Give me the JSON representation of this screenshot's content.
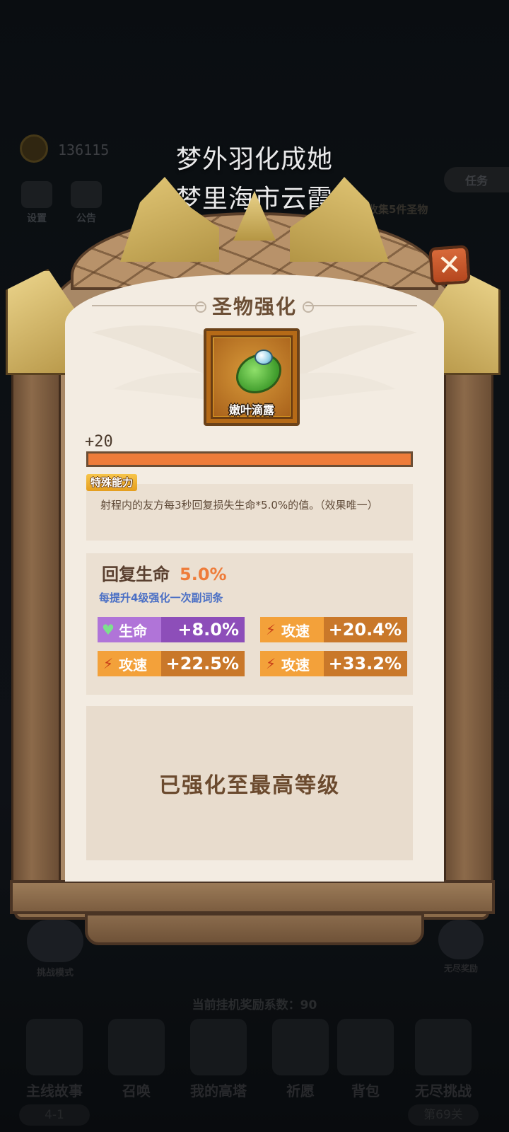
{
  "hud": {
    "coins": "136115",
    "settings_label": "设置",
    "notice_label": "公告",
    "task_label": "任务",
    "task_text": "收集5件圣物"
  },
  "lyrics": {
    "line1": "梦外羽化成她",
    "line2": "梦里海市云霞"
  },
  "panel": {
    "title": "圣物强化",
    "close_icon": "close-icon",
    "item": {
      "name": "嫩叶滴露",
      "icon": "leaf-dew-icon"
    },
    "level": {
      "label": "+20",
      "progress": 1.0
    },
    "special": {
      "tag": "特殊能力",
      "description": "射程内的友方每3秒回复损失生命*5.0%的值。（效果唯一）"
    },
    "main_stat": {
      "name": "回复生命",
      "value": "5.0%"
    },
    "upgrade_note": "每提升4级强化一次副词条",
    "substats": [
      {
        "icon": "heart-icon",
        "name": "生命",
        "value": "+8.0%",
        "color": "#8d4eb9"
      },
      {
        "icon": "bolt-icon",
        "name": "攻速",
        "value": "+20.4%",
        "color": "#c9782a"
      },
      {
        "icon": "bolt-icon",
        "name": "攻速",
        "value": "+22.5%",
        "color": "#c9782a"
      },
      {
        "icon": "bolt-icon",
        "name": "攻速",
        "value": "+33.2%",
        "color": "#c9782a"
      }
    ],
    "max_text": "已强化至最高等级"
  },
  "bottom": {
    "challenge_label": "挑战模式",
    "endless_reward_label": "无尽奖励",
    "idle_text": "当前挂机奖励系数：90",
    "nav": [
      {
        "label": "主线故事",
        "sub": "4-1"
      },
      {
        "label": "召唤",
        "sub": ""
      },
      {
        "label": "我的高塔",
        "sub": ""
      },
      {
        "label": "祈愿",
        "sub": ""
      },
      {
        "label": "背包",
        "sub": ""
      },
      {
        "label": "无尽挑战",
        "sub": "第69关"
      }
    ]
  }
}
